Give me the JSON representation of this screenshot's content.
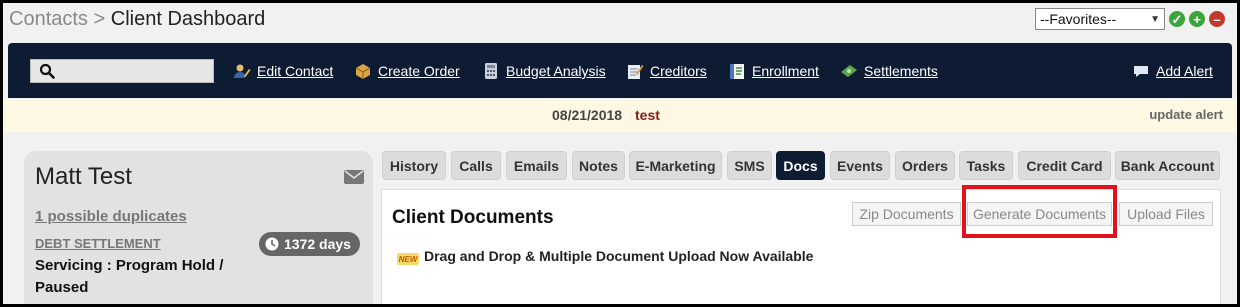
{
  "breadcrumb": {
    "root": "Contacts",
    "separator": ">",
    "current": "Client Dashboard"
  },
  "favorites": {
    "selected": "--Favorites--"
  },
  "header_actions": [
    {
      "name": "check",
      "color": "#3ba53b"
    },
    {
      "name": "add",
      "color": "#3ba53b"
    },
    {
      "name": "remove",
      "color": "#c0392b"
    }
  ],
  "search": {
    "value": "",
    "placeholder": ""
  },
  "nav": {
    "items": [
      {
        "label": "Edit Contact",
        "icon": "edit-contact-icon"
      },
      {
        "label": "Create Order",
        "icon": "create-order-icon"
      },
      {
        "label": "Budget Analysis",
        "icon": "calculator-icon"
      },
      {
        "label": "Creditors",
        "icon": "creditors-icon"
      },
      {
        "label": "Enrollment",
        "icon": "enrollment-icon"
      },
      {
        "label": "Settlements",
        "icon": "money-icon"
      }
    ],
    "add_alert": "Add Alert"
  },
  "alert": {
    "date": "08/21/2018",
    "text": "test",
    "update_label": "update alert"
  },
  "contact": {
    "name": "Matt Test",
    "duplicates": "1 possible duplicates",
    "program": "DEBT SETTLEMENT",
    "days": "1372 days",
    "status": "Servicing : Program Hold / Paused"
  },
  "tabs": [
    "History",
    "Calls",
    "Emails",
    "Notes",
    "E-Marketing",
    "SMS",
    "Docs",
    "Events",
    "Orders",
    "Tasks",
    "Credit Card",
    "Bank Account"
  ],
  "active_tab": "Docs",
  "docs": {
    "title": "Client Documents",
    "buttons": [
      "Zip Documents",
      "Generate Documents",
      "Upload Files"
    ],
    "new_badge": "NEW",
    "notice": "Drag and Drop & Multiple Document Upload Now Available"
  },
  "colors": {
    "navy": "#0d1b33",
    "alert_bg": "#fcf8e3",
    "highlight": "#e0121b"
  }
}
